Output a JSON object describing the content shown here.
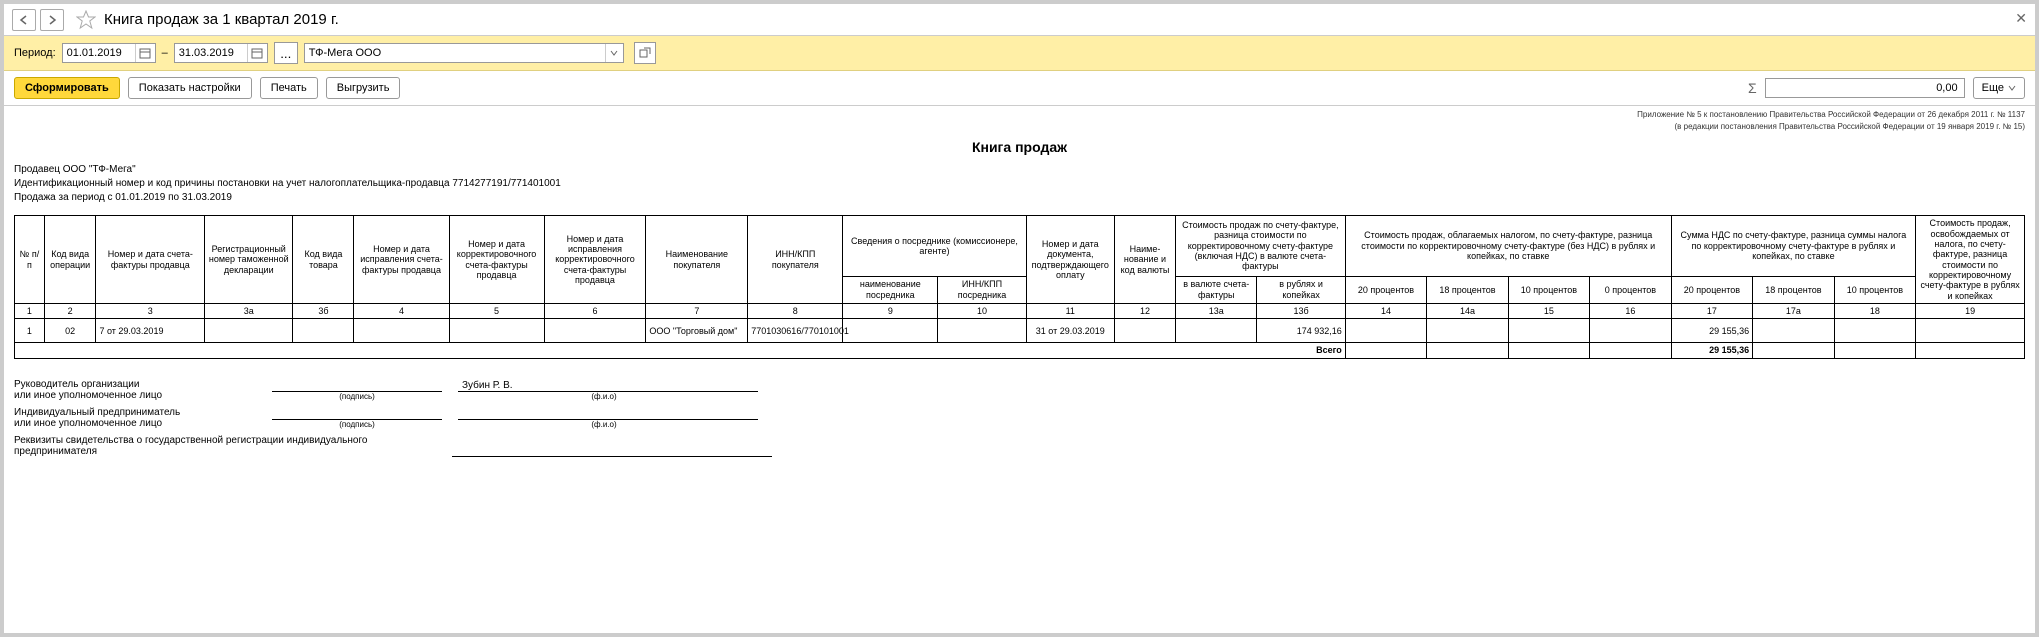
{
  "title": "Книга продаж за 1 квартал 2019 г.",
  "period_label": "Период:",
  "date_from": "01.01.2019",
  "date_to": "31.03.2019",
  "dash": "–",
  "org": "ТФ-Мега ООО",
  "btn_form": "Сформировать",
  "btn_settings": "Показать настройки",
  "btn_print": "Печать",
  "btn_export": "Выгрузить",
  "sum_value": "0,00",
  "btn_more": "Еще",
  "decree1": "Приложение № 5 к постановлению Правительства Российской Федерации от 26 декабря 2011 г. № 1137",
  "decree2": "(в редакции постановления Правительства Российской Федерации от 19 января 2019 г. № 15)",
  "report_title": "Книга продаж",
  "seller_line": "Продавец  ООО \"ТФ-Мега\"",
  "inn_line": "Идентификационный номер и код причины постановки на учет налогоплательщика-продавца   7714277191/771401001",
  "period_line": "Продажа за период с 01.01.2019 по 31.03.2019",
  "h": {
    "c1": "№ п/п",
    "c2": "Код вида опера­ции",
    "c3": "Номер и дата счета-фактуры продавца",
    "c3a": "Регистрацио­нный номер таможенной декларации",
    "c3b": "Код вида товара",
    "c4": "Номер и дата исправления счета-фактуры продавца",
    "c5": "Номер и дата корректиро­вочного счета-фактуры продавца",
    "c6": "Номер и дата исправления корректиро­вочного счета-фактуры продавца",
    "c7": "Наименование покупателя",
    "c8": "ИНН/КПП покупателя",
    "c9g": "Сведения о посреднике (комиссионере, агенте)",
    "c9": "наименование посредника",
    "c10": "ИНН/КПП посредника",
    "c11": "Номер и дата документа, подтвержда­ющего оплату",
    "c12": "Наиме­нование и код валюты",
    "c13g": "Стоимость продаж по счету-фактуре, разница стоимости по корректировочному счету-фактуре (включая НДС) в валюте счета-фактуры",
    "c13a": "в валюте счета-фактуры",
    "c13b": "в рублях и копейках",
    "c14g": "Стоимость продаж, облагаемых налогом, по счету-фактуре, разница стоимости по корректировочному счету-фактуре (без НДС) в рублях и копейках, по ставке",
    "c14": "20 процентов",
    "c14a": "18 процентов",
    "c15": "10 процентов",
    "c16": "0 процентов",
    "c17g": "Сумма НДС по счету-фактуре, разница суммы налога по корректировочному счету-фактуре в рублях и копейках, по ставке",
    "c17": "20 процентов",
    "c17a": "18 процентов",
    "c18": "10 процентов",
    "c19": "Стоимость продаж, освобождаемых от налога, по счету-фактуре, разница стоимости по корректиро­вочному счету-фактуре в рублях и копейках"
  },
  "nums": [
    "1",
    "2",
    "3",
    "3а",
    "3б",
    "4",
    "5",
    "6",
    "7",
    "8",
    "9",
    "10",
    "11",
    "12",
    "13а",
    "13б",
    "14",
    "14а",
    "15",
    "16",
    "17",
    "17а",
    "18",
    "19"
  ],
  "row": {
    "n": "1",
    "code": "02",
    "sf": "7 от 29.03.2019",
    "buyer": "ООО \"Торговый дом\"",
    "inn": "7701030616/770101001",
    "doc": "31 от 29.03.2019",
    "sum_rub": "174 932,16",
    "vat20": "29 155,36"
  },
  "total_label": "Всего",
  "total_vat20": "29 155,36",
  "sig": {
    "head": "Руководитель организации",
    "head2": "или иное уполномоченное лицо",
    "podpis": "(подпись)",
    "fio": "(ф.и.о)",
    "name": "Зубин Р. В.",
    "ip": "Индивидуальный предприниматель",
    "ip2": "или иное уполномоченное лицо",
    "rekv": "Реквизиты свидетельства о государственной регистрации индивидуального предпринимателя"
  }
}
